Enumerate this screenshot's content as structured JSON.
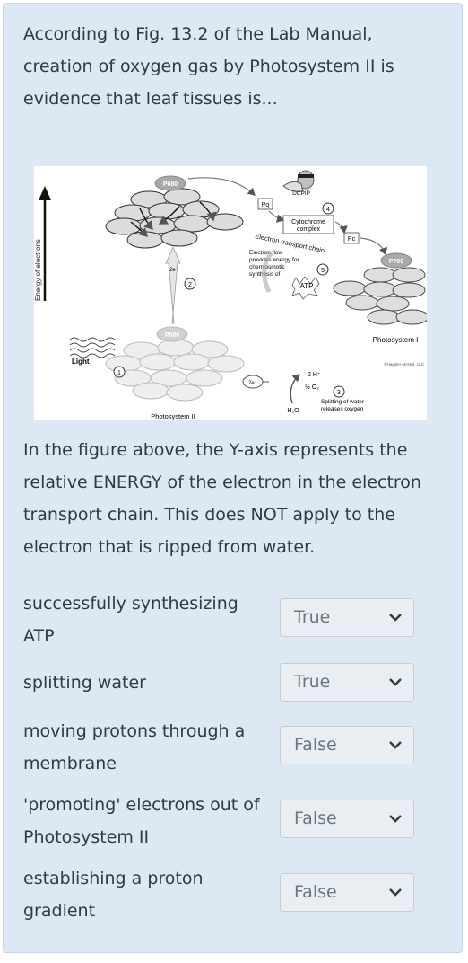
{
  "question": {
    "text": "According to Fig. 13.2 of the Lab Manual, creation of oxygen gas by Photosystem II is evidence that leaf tissues is..."
  },
  "figure": {
    "y_axis_label": "Energy of electrons",
    "p680_top": "P680",
    "p680_bottom": "P680",
    "p700": "P700",
    "pq": "Pq",
    "pc": "Pc",
    "dcpip": "DCPIP",
    "cytochrome_line1": "Cytochrome",
    "cytochrome_line2": "complex",
    "etc_label": "Electron transport chain",
    "flow_line1": "Electron flow",
    "flow_line2": "provides energy for",
    "flow_line3": "chemiosmotic",
    "flow_line4": "synthesis of",
    "atp": "ATP",
    "light": "Light",
    "two_e_up": "2e⁻",
    "two_e_left": "2e⁻",
    "two_h": "2 H⁺",
    "half_o2": "½ O₂",
    "water": "H₂O",
    "splitting_line1": "Splitting of water",
    "splitting_line2": "releases oxygen",
    "photosystem_i": "Photosystem I",
    "photosystem_ii": "Photosystem II",
    "copyright": "©Hayden-McNeil, LLC",
    "steps": [
      "1",
      "2",
      "3",
      "4",
      "5"
    ]
  },
  "note": {
    "text": "In the figure above, the Y-axis represents the relative ENERGY of the electron in the electron transport chain.  This does NOT apply to the electron that is ripped from water."
  },
  "answers": [
    {
      "statement": "successfully synthesizing ATP",
      "selected": "True"
    },
    {
      "statement": "splitting water",
      "selected": "True"
    },
    {
      "statement": "moving protons through a membrane",
      "selected": "False"
    },
    {
      "statement": "'promoting' electrons out of Photosystem II",
      "selected": "False"
    },
    {
      "statement": "establishing a proton gradient",
      "selected": "False"
    }
  ],
  "icons": {
    "dropdown": "chevron-down-icon"
  },
  "colors": {
    "card_background": "#dce9f5",
    "select_background": "#e9eef2",
    "text": "#2d3b45",
    "select_text": "#6b7780",
    "p_center": "#a9a9a9"
  }
}
